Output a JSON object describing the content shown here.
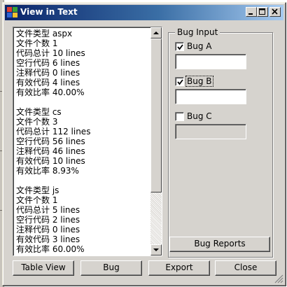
{
  "window": {
    "title": "View in Text",
    "icon": "app-window-icon",
    "controls": [
      "minimize-icon",
      "maximize-icon",
      "close-icon"
    ]
  },
  "report": {
    "lines": [
      "文件类型 aspx",
      "文件个数 1",
      "代码总计 10 lines",
      "空行代码 6 lines",
      "注释代码 0 lines",
      "有效代码 4 lines",
      "有效比率 40.00%",
      "",
      "文件类型 cs",
      "文件个数 3",
      "代码总计 112 lines",
      "空行代码 56 lines",
      "注释代码 46 lines",
      "有效代码 10 lines",
      "有效比率 8.93%",
      "",
      "文件类型 js",
      "文件个数 1",
      "代码总计 5 lines",
      "空行代码 2 lines",
      "注释代码 0 lines",
      "有效代码 3 lines",
      "有效比率 60.00%"
    ]
  },
  "bug_input": {
    "title": "Bug Input",
    "items": [
      {
        "label": "Bug A",
        "checked": true,
        "value": "",
        "enabled": true
      },
      {
        "label": "Bug B",
        "checked": true,
        "value": "",
        "enabled": true
      },
      {
        "label": "Bug C",
        "checked": false,
        "value": "",
        "enabled": false
      }
    ],
    "reports_button": "Bug Reports"
  },
  "buttons": {
    "table_view": "Table View",
    "bug": "Bug",
    "export": "Export",
    "close": "Close"
  },
  "colors": {
    "titlebar_start": "#0a246a",
    "titlebar_end": "#a6caf0",
    "face": "#d6d3ce"
  }
}
